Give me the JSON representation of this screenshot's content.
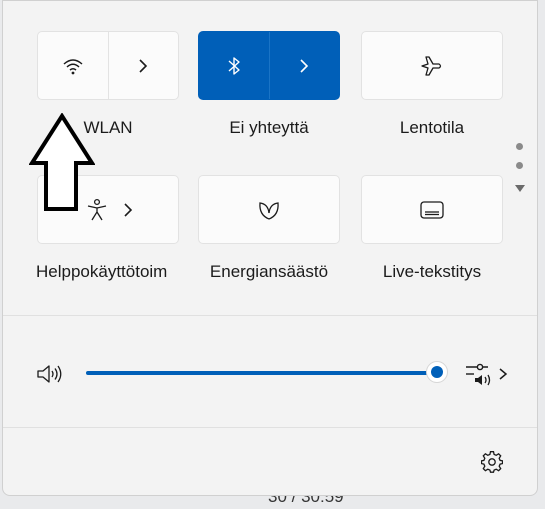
{
  "background": {
    "partial_text": "30 / 30:59"
  },
  "tiles": {
    "wlan": {
      "label": "WLAN",
      "icon": "wifi-icon"
    },
    "bluetooth": {
      "label": "Ei yhteyttä",
      "icon": "bluetooth-icon",
      "active": true
    },
    "airplane": {
      "label": "Lentotila",
      "icon": "airplane-icon"
    },
    "accessibility": {
      "label": "Helppokäyttötoim",
      "icon": "accessibility-icon"
    },
    "energy": {
      "label": "Energiansäästö",
      "icon": "leaf-icon"
    },
    "captions": {
      "label": "Live-tekstitys",
      "icon": "captions-icon"
    }
  },
  "volume": {
    "level_percent": 100
  },
  "colors": {
    "accent": "#005fb8",
    "panel": "#f3f3f3",
    "tile": "#fbfbfb"
  }
}
